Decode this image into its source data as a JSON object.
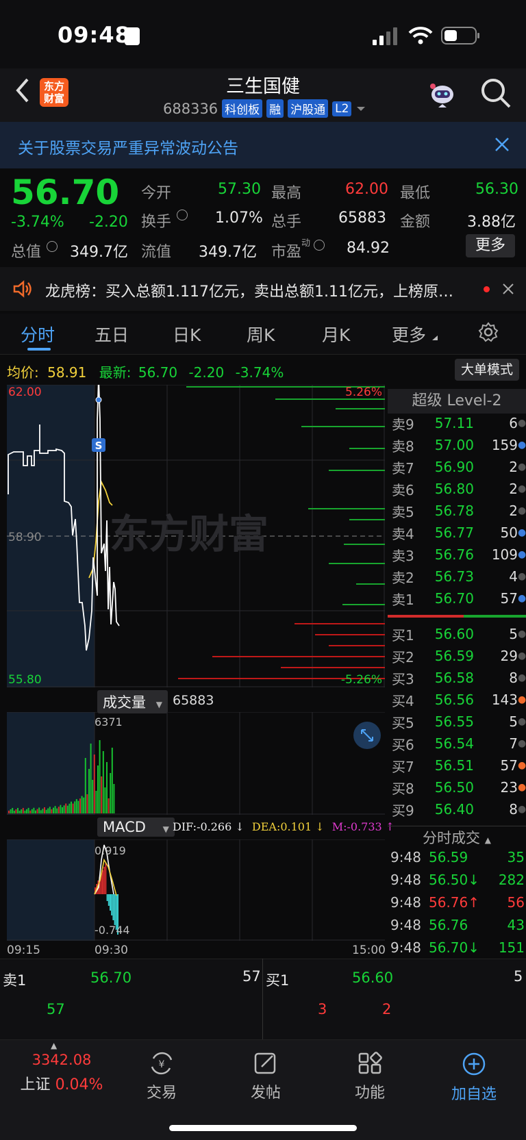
{
  "status": {
    "time": "09:48"
  },
  "header": {
    "back_icon": "chevron-left-icon",
    "logo_text": "东方财富",
    "stock_name": "三生国健",
    "code": "688336",
    "tags": [
      "科创板",
      "融",
      "沪股通",
      "L2"
    ]
  },
  "notice": {
    "text": "关于股票交易严重异常波动公告"
  },
  "quote": {
    "price": "56.70",
    "change_pct": "-3.74%",
    "change": "-2.20",
    "open_label": "今开",
    "open": "57.30",
    "high_label": "最高",
    "high": "62.00",
    "low_label": "最低",
    "low": "56.30",
    "turnover_label": "换手",
    "turnover": "1.07%",
    "volume_label": "总手",
    "volume": "65883",
    "amount_label": "金额",
    "amount": "3.88亿",
    "total_cap_label": "总值",
    "total_cap": "349.7亿",
    "float_cap_label": "流值",
    "float_cap": "349.7亿",
    "pe_label": "市盈",
    "pe_sup": "动",
    "pe": "84.92",
    "more": "更多"
  },
  "dragon": {
    "text": "龙虎榜：买入总额1.117亿元，卖出总额1.11亿元，上榜原…"
  },
  "tabs": [
    "分时",
    "五日",
    "日K",
    "周K",
    "月K",
    "更多"
  ],
  "chart_info": {
    "avg_label": "均价:",
    "avg": "58.91",
    "latest_label": "最新:",
    "latest": "56.70",
    "latest_change": "-2.20",
    "latest_pct": "-3.74%",
    "dadan": "大单模式",
    "y_top": "62.00",
    "y_mid": "58.90",
    "y_bottom": "55.80",
    "pct_top": "5.26%",
    "pct_bottom": "-5.26%",
    "watermark": "东方财富",
    "s_marker": "S",
    "vol_btn": "成交量",
    "vol_total": "65883",
    "vol_max": "6371",
    "macd_btn": "MACD",
    "dif": "DIF:-0.266 ↓",
    "dea": "DEA:0.101 ↓",
    "m": "M:-0.733 ↑",
    "macd_top": "0.919",
    "macd_bottom": "-0.744",
    "t_start": "09:15",
    "t_mid": "09:30",
    "t_end": "15:00"
  },
  "orderbook": {
    "title": "超级 Level-2",
    "asks": [
      {
        "k": "卖9",
        "p": "57.11",
        "q": "6",
        "dot": "#555"
      },
      {
        "k": "卖8",
        "p": "57.00",
        "q": "159",
        "dot": "#3b7ddd"
      },
      {
        "k": "卖7",
        "p": "56.90",
        "q": "2",
        "dot": "#555"
      },
      {
        "k": "卖6",
        "p": "56.80",
        "q": "2",
        "dot": "#555"
      },
      {
        "k": "卖5",
        "p": "56.78",
        "q": "2",
        "dot": "#555"
      },
      {
        "k": "卖4",
        "p": "56.77",
        "q": "50",
        "dot": "#3b7ddd"
      },
      {
        "k": "卖3",
        "p": "56.76",
        "q": "109",
        "dot": "#3b7ddd"
      },
      {
        "k": "卖2",
        "p": "56.73",
        "q": "4",
        "dot": "#555"
      },
      {
        "k": "卖1",
        "p": "56.70",
        "q": "57",
        "dot": "#3b7ddd"
      }
    ],
    "bids": [
      {
        "k": "买1",
        "p": "56.60",
        "q": "5",
        "dot": "#555"
      },
      {
        "k": "买2",
        "p": "56.59",
        "q": "29",
        "dot": "#555"
      },
      {
        "k": "买3",
        "p": "56.58",
        "q": "8",
        "dot": "#555"
      },
      {
        "k": "买4",
        "p": "56.56",
        "q": "143",
        "dot": "#f06a2a"
      },
      {
        "k": "买5",
        "p": "56.55",
        "q": "5",
        "dot": "#555"
      },
      {
        "k": "买6",
        "p": "56.54",
        "q": "7",
        "dot": "#555"
      },
      {
        "k": "买7",
        "p": "56.51",
        "q": "57",
        "dot": "#f06a2a"
      },
      {
        "k": "买8",
        "p": "56.50",
        "q": "23",
        "dot": "#f06a2a"
      },
      {
        "k": "买9",
        "p": "56.40",
        "q": "8",
        "dot": "#555"
      }
    ]
  },
  "ticks": {
    "title": "分时成交",
    "rows": [
      {
        "t": "9:48",
        "p": "56.59",
        "pc": "#18d438",
        "v": "35",
        "vc": "#18d438"
      },
      {
        "t": "9:48",
        "p": "56.50↓",
        "pc": "#18d438",
        "v": "282",
        "vc": "#18d438"
      },
      {
        "t": "9:48",
        "p": "56.76↑",
        "pc": "#ff3b3b",
        "v": "56",
        "vc": "#ff3b3b"
      },
      {
        "t": "9:48",
        "p": "56.76",
        "pc": "#18d438",
        "v": "43",
        "vc": "#18d438"
      },
      {
        "t": "9:48",
        "p": "56.70↓",
        "pc": "#18d438",
        "v": "151",
        "vc": "#18d438"
      }
    ]
  },
  "bottom_quote": {
    "sell_label": "卖1",
    "sell_price": "56.70",
    "sell_qty": "57",
    "sell_sub": "57",
    "buy_label": "买1",
    "buy_price": "56.60",
    "buy_qty": "5",
    "buy_sub1": "3",
    "buy_sub2": "2"
  },
  "nav": {
    "index_value": "3342.08",
    "index_label": "上证",
    "index_pct": "0.04%",
    "trade": "交易",
    "post": "发帖",
    "func": "功能",
    "add": "加自选"
  }
}
